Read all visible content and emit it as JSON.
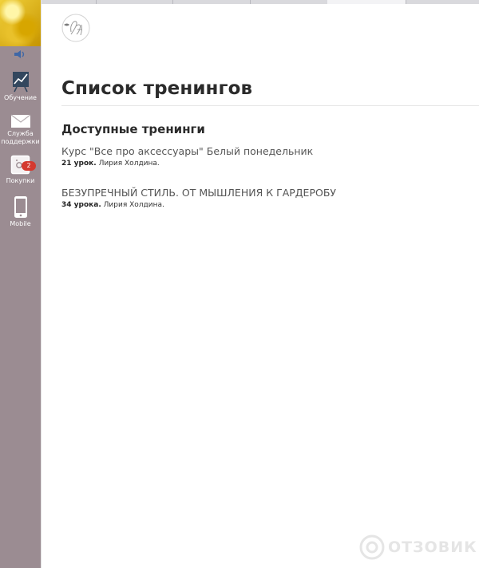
{
  "sidebar": {
    "items": [
      {
        "label": "Обучение",
        "icon": "chart-easel-icon"
      },
      {
        "label": "Служба поддержки",
        "icon": "envelope-icon"
      },
      {
        "label": "Покупки",
        "icon": "shopping-box-icon",
        "badge": "2"
      },
      {
        "label": "Mobile",
        "icon": "mobile-phone-icon"
      }
    ]
  },
  "main": {
    "page_title": "Список тренингов",
    "section_title": "Доступные тренинги",
    "trainings": [
      {
        "title": "Курс \"Все про аксессуары\" Белый понедельник",
        "lessons": "21 урок.",
        "author": "Лирия Холдина."
      },
      {
        "title": "БЕЗУПРЕЧНЫЙ СТИЛЬ. ОТ МЫШЛЕНИЯ К ГАРДЕРОБУ",
        "lessons": "34 урока.",
        "author": "Лирия Холдина."
      }
    ]
  },
  "watermark": {
    "text": "ОТЗОВИК"
  },
  "colors": {
    "sidebar": "#9b8c92",
    "badge": "#d43a2f",
    "title": "#2b2b2b",
    "text": "#555555"
  }
}
